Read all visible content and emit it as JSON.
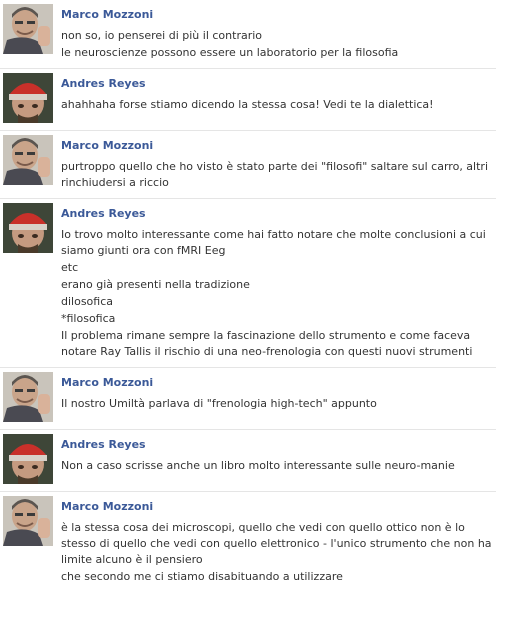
{
  "messages": [
    {
      "author": "Marco Mozzoni",
      "avatar": "marco",
      "lines": [
        "non so, io penserei di più il contrario",
        "le neuroscienze possono essere un laboratorio per la filosofia"
      ]
    },
    {
      "author": "Andres Reyes",
      "avatar": "andres",
      "lines": [
        "ahahhaha forse stiamo dicendo la stessa cosa! Vedi te la dialettica!"
      ]
    },
    {
      "author": "Marco Mozzoni",
      "avatar": "marco",
      "lines": [
        "purtroppo quello che ho visto è stato parte dei \"filosofi\" saltare sul carro, altri rinchiudersi a riccio"
      ]
    },
    {
      "author": "Andres Reyes",
      "avatar": "andres",
      "lines": [
        "Io trovo molto interessante come hai fatto notare che molte conclusioni a cui siamo giunti ora con fMRI Eeg",
        "etc",
        "erano già presenti nella tradizione",
        "dilosofica",
        "*filosofica",
        "Il problema rimane sempre la fascinazione dello strumento e come faceva notare Ray Tallis il rischio di una neo-frenologia con questi nuovi strumenti"
      ]
    },
    {
      "author": "Marco Mozzoni",
      "avatar": "marco",
      "lines": [
        "Il nostro Umiltà parlava di \"frenologia high-tech\" appunto"
      ]
    },
    {
      "author": "Andres Reyes",
      "avatar": "andres",
      "lines": [
        "Non a caso scrisse anche un libro molto interessante sulle neuro-manie"
      ]
    },
    {
      "author": "Marco Mozzoni",
      "avatar": "marco",
      "lines": [
        "è la stessa cosa dei microscopi, quello che vedi con quello ottico non è lo stesso di quello che vedi con quello elettronico - l'unico strumento che non ha limite alcuno è il pensiero",
        "che secondo me ci stiamo disabituando a utilizzare"
      ]
    }
  ],
  "colors": {
    "author_link": "#3b5998",
    "text": "#333333",
    "divider": "#e5e5e5"
  }
}
